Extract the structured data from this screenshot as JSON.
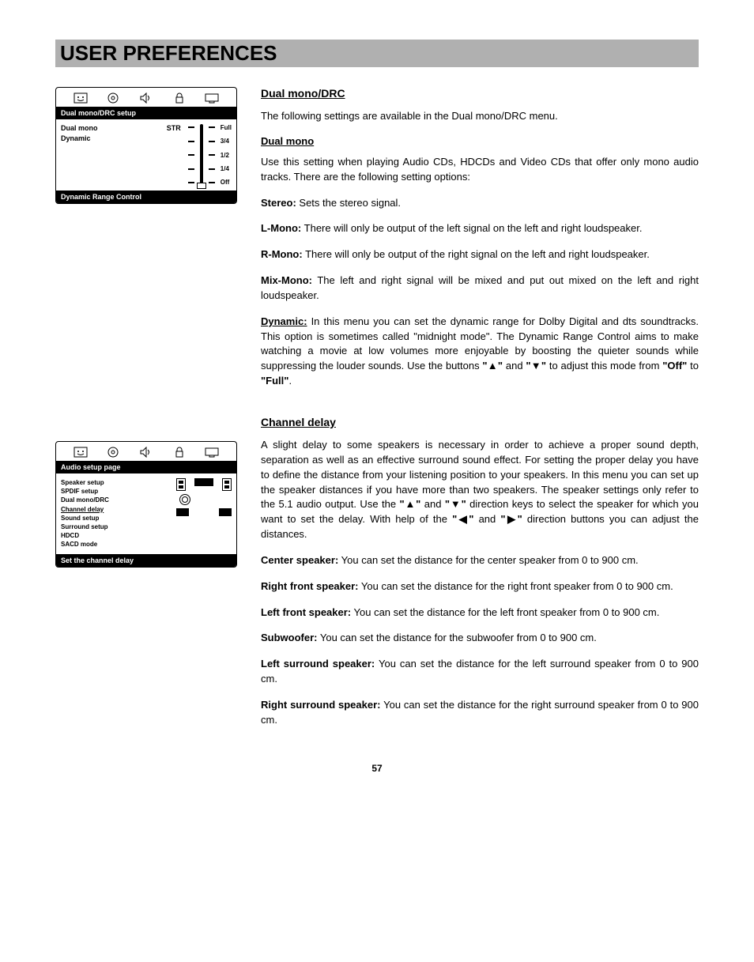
{
  "page": {
    "title": "USER PREFERENCES",
    "number": "57"
  },
  "menu1": {
    "header": "Dual mono/DRC setup",
    "row1a": "Dual mono",
    "row1b": "STR",
    "row2": "Dynamic",
    "slider": [
      "Full",
      "3/4",
      "1/2",
      "1/4",
      "Off"
    ],
    "footer": "Dynamic Range Control"
  },
  "menu2": {
    "header": "Audio setup page",
    "items": [
      "Speaker setup",
      "SPDIF setup",
      "Dual mono/DRC",
      "Channel delay",
      "Sound setup",
      "Surround setup",
      "HDCD",
      "SACD mode"
    ],
    "footer": "Set the channel delay"
  },
  "sec1": {
    "heading": "Dual mono/DRC",
    "intro": "The following settings are available in the Dual mono/DRC menu.",
    "subhead": "Dual mono",
    "p1": "Use this setting when playing Audio CDs, HDCDs and Video CDs that offer only mono audio tracks. There are the following setting options:",
    "stereo_l": "Stereo:",
    "stereo_t": " Sets the stereo signal.",
    "lmono_l": "L-Mono:",
    "lmono_t": " There will only be output of the left signal on the left and right loudspeaker.",
    "rmono_l": "R-Mono:",
    "rmono_t": " There will only be output of the right signal on the left and right loudspeaker.",
    "mix_l": "Mix-Mono:",
    "mix_t": " The left and right signal will be mixed and put out mixed on the left and right loudspeaker.",
    "dyn_l": "Dynamic:",
    "dyn_t1": " In this menu you can set the dynamic range for Dolby Digital and dts soundtracks. This option is sometimes called \"midnight mode\". The Dynamic Range Control aims to make watching a movie at low volumes more enjoyable by boosting the quieter sounds while suppressing the louder sounds. Use the buttons ",
    "up": "\"▲\"",
    "and": " and ",
    "down": "\"▼\"",
    "dyn_t2": " to adjust this mode from ",
    "off": "\"Off\"",
    "to": " to ",
    "full": "\"Full\"",
    "dot": "."
  },
  "sec2": {
    "heading": "Channel delay",
    "p1a": "A slight delay to some speakers is necessary in order to achieve a proper sound depth, separation as well as an effective surround sound effect. For setting the proper delay you have to define the distance from your listening position to your speakers. In this menu you can set up the speaker distances if you have more than two speakers. The speaker settings only refer to the 5.1 audio output. Use the ",
    "up": "\"▲\"",
    "and1": " and ",
    "down": "\"▼\"",
    "p1b": " direction keys to select the speaker for which you want to set the delay. With help of the ",
    "left": "\"◀\"",
    "and2": " and ",
    "right": "\"▶\"",
    "p1c": " direction buttons you can adjust the distances.",
    "ctr_l": "Center speaker:",
    "ctr_t": " You can set the distance for the center speaker from 0 to 900 cm.",
    "rf_l": "Right front speaker:",
    "rf_t": " You can set the distance for the right front speaker from 0 to 900 cm.",
    "lf_l": "Left front speaker:",
    "lf_t": " You can set the distance for the left front speaker from 0 to 900 cm.",
    "sub_l": "Subwoofer:",
    "sub_t": " You can set the distance for the subwoofer from 0 to 900 cm.",
    "ls_l": "Left surround speaker:",
    "ls_t": " You can set the distance for the left surround speaker from 0 to 900 cm.",
    "rs_l": "Right surround speaker:",
    "rs_t": " You can set the distance for the right surround speaker from 0 to 900 cm."
  }
}
